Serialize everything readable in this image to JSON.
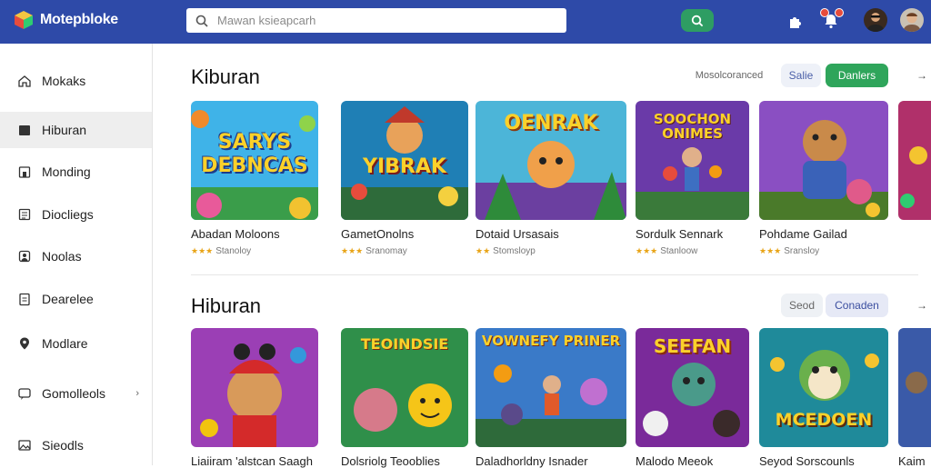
{
  "header": {
    "app_name": "Motepbloke",
    "search_placeholder": "Mawan ksieapcarh",
    "search_button_icon": "search-icon",
    "accent_color": "#2e4aa8"
  },
  "sidebar": {
    "items": [
      {
        "label": "Mokaks",
        "icon": "home-icon"
      },
      {
        "label": "Hiburan",
        "icon": "folder-icon",
        "active": true
      },
      {
        "label": "Monding",
        "icon": "house-icon"
      },
      {
        "label": "Diocliegs",
        "icon": "grid-icon"
      },
      {
        "label": "Noolas",
        "icon": "person-icon"
      },
      {
        "label": "Dearelee",
        "icon": "clipboard-icon"
      },
      {
        "label": "Modlare",
        "icon": "pin-icon"
      },
      {
        "label": "Gomolleols",
        "icon": "chat-icon",
        "chevron": "›"
      },
      {
        "label": "Sieodls",
        "icon": "image-icon"
      }
    ]
  },
  "sections": [
    {
      "title": "Kiburan",
      "link_label": "Mosolcoranced",
      "chips": [
        "Salie",
        "Danlers"
      ],
      "arrow": "→",
      "cards": [
        {
          "title": "Abadan Moloons",
          "stars": "★★★",
          "meta": "Stanoloy"
        },
        {
          "title": "GametOnolns",
          "stars": "★★★",
          "meta": "Sranomay"
        },
        {
          "title": "Dotaid Ursasais",
          "stars": "★★",
          "meta": "Stomsloyp"
        },
        {
          "title": "Sordulk Sennark",
          "stars": "★★★",
          "meta": "Stanloow"
        },
        {
          "title": "Pohdame Gailad",
          "stars": "★★★",
          "meta": "Sransloy"
        }
      ],
      "thumb_texts": [
        "SARYS DEBNCAS",
        "YIBRAK",
        "OENRAK",
        "SOOCHON ONIMES",
        ""
      ]
    },
    {
      "title": "Hiburan",
      "chips": [
        "Seod",
        "Conaden"
      ],
      "arrow": "→",
      "cards": [
        {
          "title": "Liaiiram 'alstcan Saagh"
        },
        {
          "title": "Dolsriolg Teooblies"
        },
        {
          "title": "Daladhorldny Isnader"
        },
        {
          "title": "Malodo Meeok"
        },
        {
          "title": "Seyod Sorscounls"
        },
        {
          "title": "Kaim"
        }
      ],
      "thumb_texts": [
        "",
        "TEOINDSIE",
        "VOWNEFY PRINER",
        "SEEFAN",
        "MCEDOEN"
      ]
    }
  ]
}
